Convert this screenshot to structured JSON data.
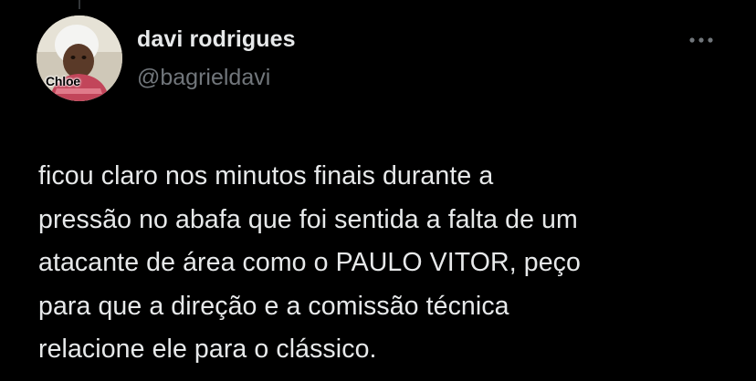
{
  "author": {
    "display_name": "davi rodrigues",
    "handle": "@bagrieldavi",
    "avatar_caption": "Chloe"
  },
  "tweet": {
    "lines": [
      "ficou claro nos minutos finais durante a",
      "pressão no abafa que foi sentida a falta de um",
      "atacante de área como o PAULO VITOR, peço",
      "para que a direção e a comissão técnica",
      "relacione ele para o clássico."
    ]
  },
  "icons": {
    "more": "more-horizontal-icon"
  },
  "colors": {
    "background": "#000000",
    "primary_text": "#e7e9ea",
    "secondary_text": "#71767b"
  }
}
